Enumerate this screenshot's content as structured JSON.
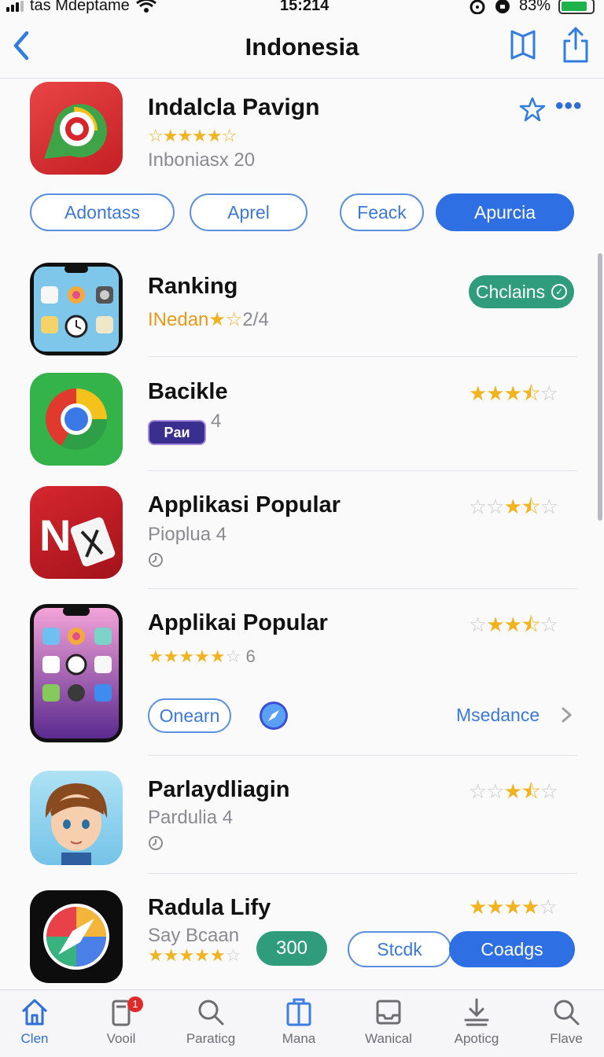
{
  "status": {
    "carrier": "tas Mdeptame",
    "time": "15:214",
    "battery": "83%",
    "battery_level": 0.83
  },
  "nav": {
    "title": "Indonesia",
    "back_icon": "chevron-left-icon",
    "bookmark_icon": "book-icon",
    "share_icon": "share-icon"
  },
  "featured": {
    "title": "Indalcla Pavign",
    "rating_stars": "☆★★★★☆",
    "subtitle": "Inboniasx 20",
    "more_label": "•••",
    "chips": [
      "Adontass",
      "Aprel",
      "Feack",
      "Apurcia"
    ]
  },
  "rows": [
    {
      "title": "Ranking",
      "subtitle_prefix": "INedan",
      "subtitle_stars": "★☆",
      "subtitle_suffix": "2/4",
      "badge": "Chclains"
    },
    {
      "title": "Bacikle",
      "pill": "Paи",
      "subtitle": "4",
      "stars_gold": "★★★⯪",
      "stars_grey": "☆"
    },
    {
      "title": "Applikasi Popular",
      "subtitle": "Pioplua 4",
      "stars_grey": "☆☆",
      "stars_gold": "★⯪",
      "stars_grey_end": "☆"
    },
    {
      "title": "Applikai Popular",
      "sub_stars": "★★★★★",
      "sub_stars_end": "☆",
      "sub_value": "6",
      "stars_grey": "☆",
      "stars_gold": "★★⯪",
      "stars_grey_end": "☆",
      "chip": "Onearn",
      "link": "Msedance"
    },
    {
      "title": "Parlaydliagin",
      "subtitle": "Pardulia 4",
      "stars_grey": "☆☆",
      "stars_gold": "★⯪",
      "stars_grey_end": "☆"
    },
    {
      "title": "Radula Lify",
      "subtitle": "Say Bcaan",
      "sub_stars": "★★★★★",
      "sub_stars_end": "☆",
      "stars_gold": "★★★★",
      "stars_grey": "☆",
      "price": "300",
      "btn_outline": "Stcdk",
      "btn_solid": "Coadgs"
    }
  ],
  "tabs": [
    {
      "label": "Clen"
    },
    {
      "label": "Vooil",
      "badge": "1"
    },
    {
      "label": "Paraticg"
    },
    {
      "label": "Mana"
    },
    {
      "label": "Wanical"
    },
    {
      "label": "Apoticg"
    },
    {
      "label": "Flave"
    }
  ],
  "colors": {
    "accent": "#2f6fe4",
    "green": "#2f9d7c",
    "star": "#f2b320"
  }
}
